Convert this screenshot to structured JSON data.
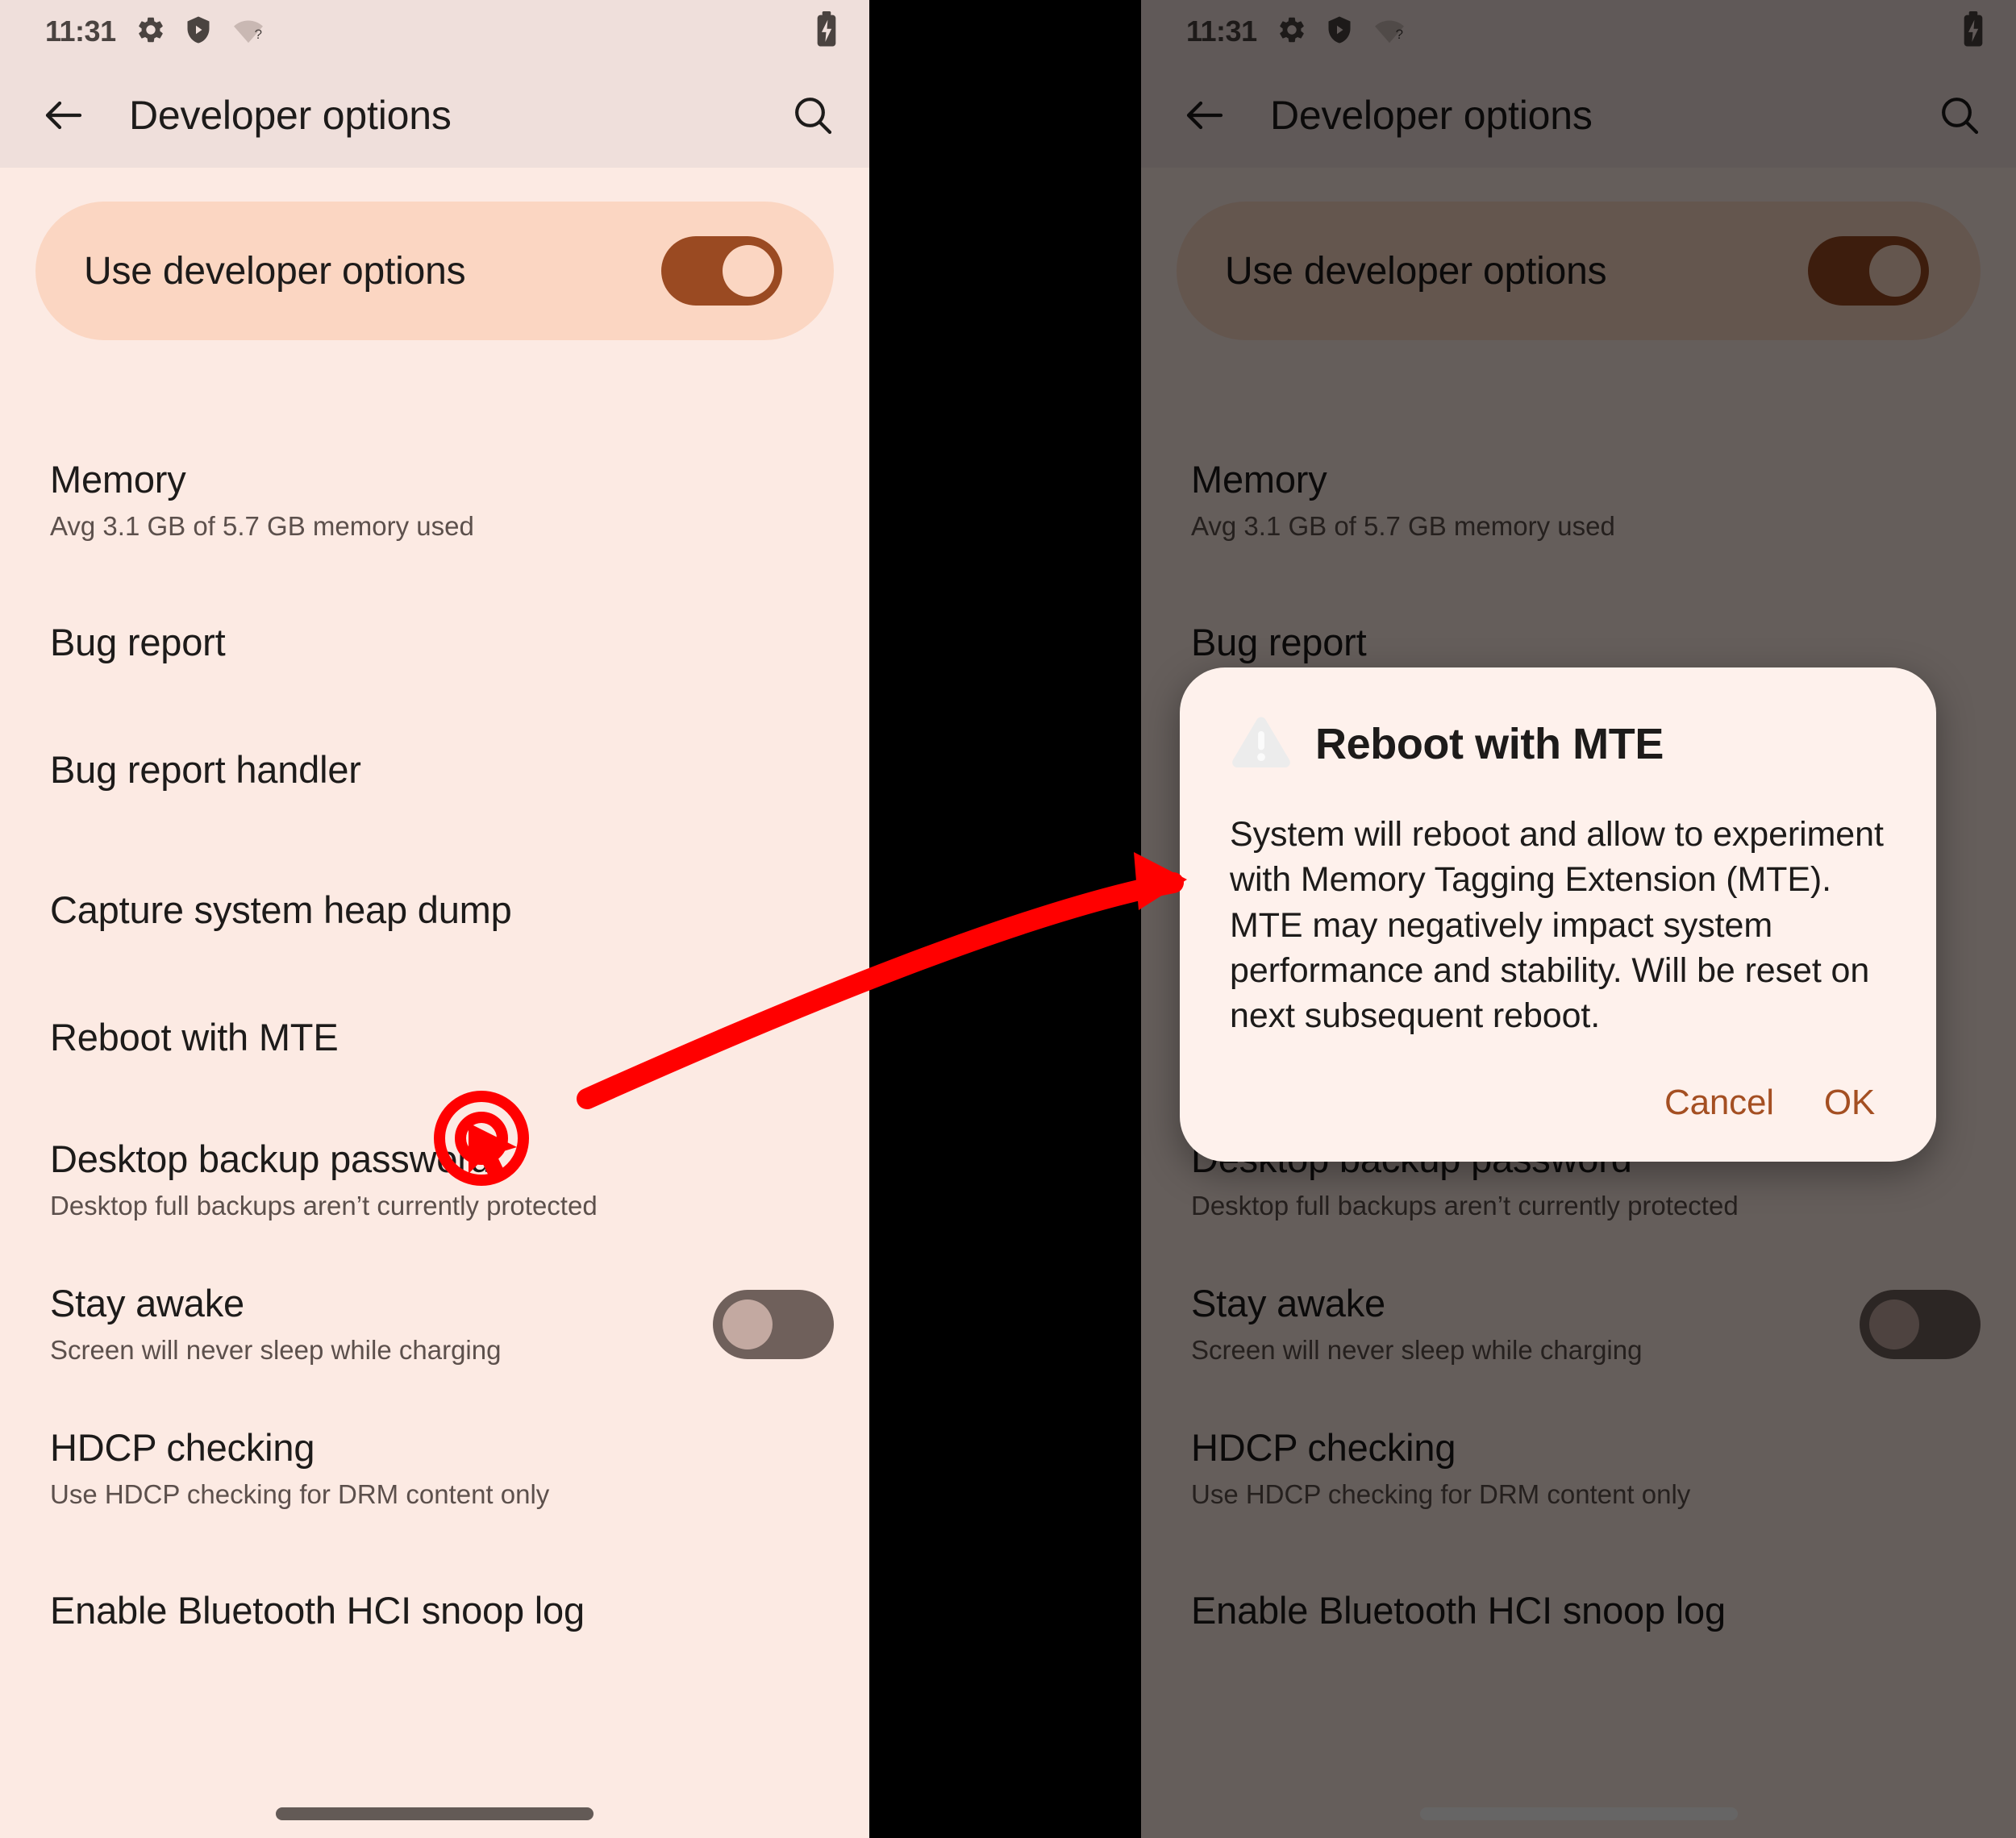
{
  "status_bar": {
    "time": "11:31",
    "icons": [
      "gear-icon",
      "shield-play-icon",
      "wifi-question-icon"
    ],
    "right_icons": [
      "battery-charging-icon"
    ]
  },
  "app_bar": {
    "back_icon": "arrow-back-icon",
    "title": "Developer options",
    "search_icon": "search-icon"
  },
  "master_toggle": {
    "label": "Use developer options",
    "state": "on"
  },
  "settings_rows": [
    {
      "title": "Memory",
      "subtitle": "Avg 3.1 GB of 5.7 GB memory used",
      "toggle": null
    },
    {
      "title": "Bug report",
      "subtitle": "",
      "toggle": null
    },
    {
      "title": "Bug report handler",
      "subtitle": "",
      "toggle": null
    },
    {
      "title": "Capture system heap dump",
      "subtitle": "",
      "toggle": null
    },
    {
      "title": "Reboot with MTE",
      "subtitle": "",
      "toggle": null
    },
    {
      "title": "Desktop backup password",
      "subtitle": "Desktop full backups aren’t currently protected",
      "toggle": null
    },
    {
      "title": "Stay awake",
      "subtitle": "Screen will never sleep while charging",
      "toggle": "off"
    },
    {
      "title": "HDCP checking",
      "subtitle": "Use HDCP checking for DRM content only",
      "toggle": null
    },
    {
      "title": "Enable Bluetooth HCI snoop log",
      "subtitle": "",
      "toggle": null
    }
  ],
  "dialog": {
    "icon": "warning-triangle-icon",
    "title": "Reboot with MTE",
    "body": "System will reboot and allow to experiment with Memory Tagging Extension (MTE). MTE may negatively impact system performance and stability. Will be reset on next subsequent reboot.",
    "cancel_label": "Cancel",
    "ok_label": "OK"
  },
  "annotation": {
    "click_target_row": "Reboot with MTE",
    "cursor_icon": "click-target-cursor-icon",
    "arrow_icon": "curved-arrow-icon",
    "color": "#FF0000"
  },
  "colors": {
    "panel_background": "#FCEAE3",
    "appbar_background": "#EFDFDB",
    "master_card_background": "#FBD6C2",
    "switch_on": "#9A4A22",
    "switch_off": "#6F605B",
    "dialog_background": "#FEF1EC",
    "dialog_action_text": "#A44F22",
    "scrim": "rgba(0,0,0,0.60)",
    "gutter": "#000000"
  }
}
